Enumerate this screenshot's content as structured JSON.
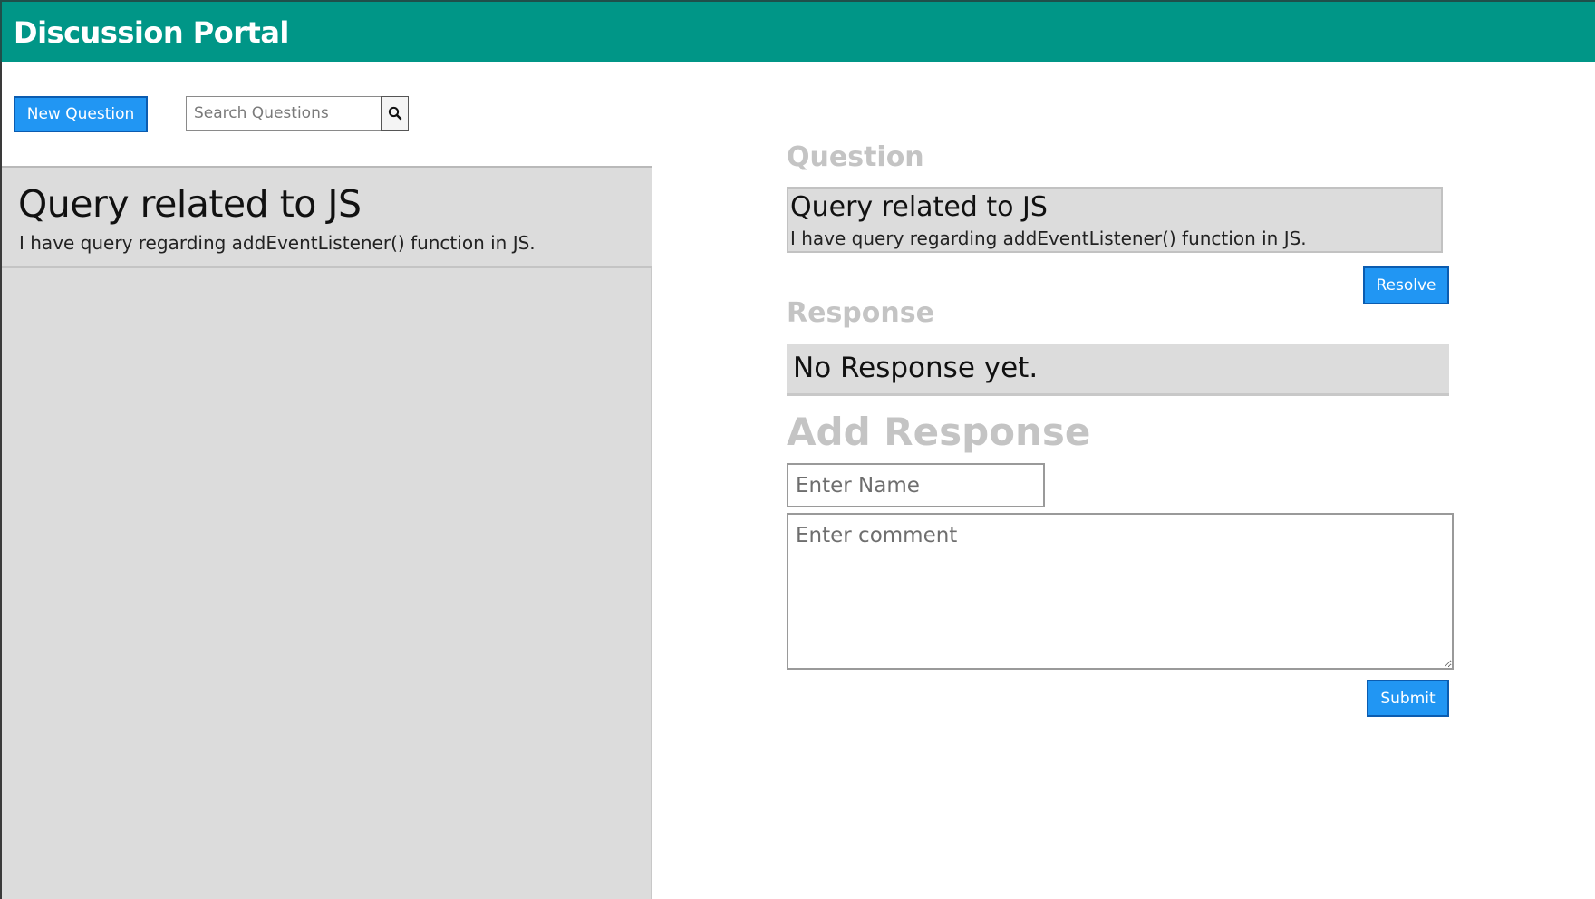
{
  "header": {
    "title": "Discussion Portal"
  },
  "toolbar": {
    "new_question_label": "New Question",
    "search_placeholder": "Search Questions",
    "search_value": ""
  },
  "questions": [
    {
      "title": "Query related to JS",
      "description": "I have query regarding addEventListener() function in JS."
    }
  ],
  "detail": {
    "question_label": "Question",
    "question": {
      "title": "Query related to JS",
      "description": "I have query regarding addEventListener() function in JS."
    },
    "resolve_label": "Resolve",
    "response_label": "Response",
    "response_text": "No Response yet.",
    "add_response_label": "Add Response",
    "name_placeholder": "Enter Name",
    "name_value": "",
    "comment_placeholder": "Enter comment",
    "comment_value": "",
    "submit_label": "Submit"
  },
  "colors": {
    "header_bg": "#009687",
    "button_bg": "#2196f3",
    "panel_bg": "#dcdcdc",
    "label_gray": "#c4c4c4"
  },
  "icons": {
    "search": "search-icon"
  }
}
